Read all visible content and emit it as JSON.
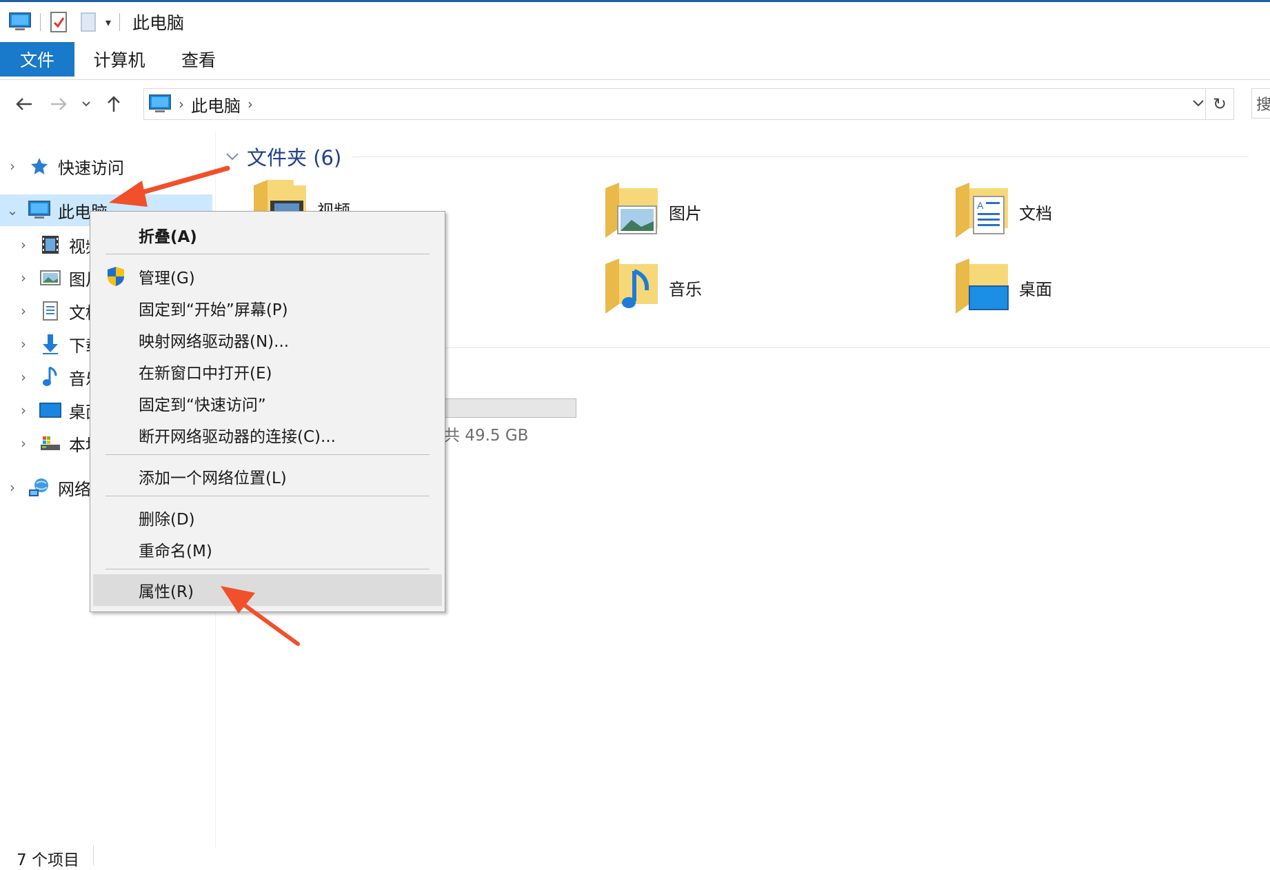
{
  "window": {
    "title": "此电脑"
  },
  "ribbon": {
    "tabs": [
      "文件",
      "计算机",
      "查看"
    ]
  },
  "address": {
    "crumbs": [
      "此电脑"
    ],
    "search_stub": "搜"
  },
  "nav_pane": {
    "items": [
      {
        "label": "快速访问",
        "icon": "quick-access-star-icon"
      },
      {
        "label": "此电脑",
        "icon": "this-pc-icon"
      },
      {
        "label": "视频",
        "icon": "videos-icon"
      },
      {
        "label": "图片",
        "icon": "pictures-icon"
      },
      {
        "label": "文档",
        "icon": "documents-icon"
      },
      {
        "label": "下载",
        "icon": "downloads-icon"
      },
      {
        "label": "音乐",
        "icon": "music-icon"
      },
      {
        "label": "桌面",
        "icon": "desktop-icon"
      },
      {
        "label": "本地磁盘 (C:)",
        "icon": "local-disk-icon"
      },
      {
        "label": "网络",
        "icon": "network-icon"
      }
    ]
  },
  "content": {
    "group_header": "文件夹 (6)",
    "folders": [
      {
        "label": "视频",
        "icon": "videos-folder-icon"
      },
      {
        "label": "图片",
        "icon": "pictures-folder-icon"
      },
      {
        "label": "文档",
        "icon": "documents-folder-icon"
      },
      {
        "label": "音乐",
        "icon": "music-folder-icon"
      },
      {
        "label": "桌面",
        "icon": "desktop-folder-icon"
      }
    ],
    "drive_free_text": "共 49.5 GB"
  },
  "context_menu": {
    "items": [
      {
        "label": "折叠(A)",
        "bold": true
      },
      {
        "label": "管理(G)",
        "icon": "uac-shield-icon"
      },
      {
        "label": "固定到“开始”屏幕(P)"
      },
      {
        "label": "映射网络驱动器(N)..."
      },
      {
        "label": "在新窗口中打开(E)"
      },
      {
        "label": "固定到“快速访问”"
      },
      {
        "label": "断开网络驱动器的连接(C)..."
      },
      {
        "label": "添加一个网络位置(L)"
      },
      {
        "label": "删除(D)"
      },
      {
        "label": "重命名(M)"
      },
      {
        "label": "属性(R)",
        "highlighted": true
      }
    ]
  },
  "status": {
    "item_count": "7 个项目"
  },
  "colors": {
    "accent": "#1979ca",
    "selection": "#cce8ff",
    "annotation_arrow": "#f0502a",
    "group_header": "#1e3f8a"
  }
}
